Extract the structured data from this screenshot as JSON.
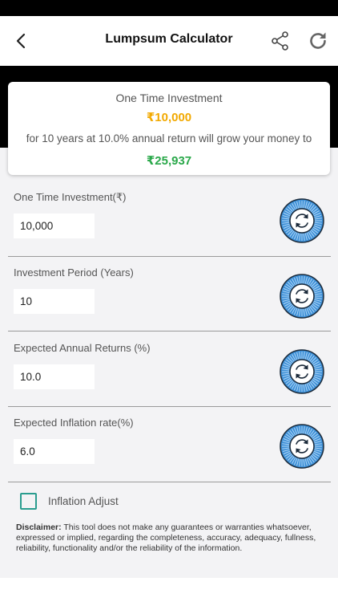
{
  "header": {
    "title": "Lumpsum Calculator",
    "back_icon": "chevron-left-icon",
    "share_icon": "share-icon",
    "refresh_icon": "refresh-icon"
  },
  "summary": {
    "title": "One Time Investment",
    "amount": "₹10,000",
    "description": "for 10 years at 10.0% annual return will grow your money to",
    "result": "₹25,937",
    "amount_color": "#f2a900",
    "result_color": "#2aa84a"
  },
  "fields": [
    {
      "label": "One Time Investment(₹)",
      "value": "10,000"
    },
    {
      "label": "Investment Period (Years)",
      "value": "10"
    },
    {
      "label": "Expected Annual Returns (%)",
      "value": "10.0"
    },
    {
      "label": "Expected Inflation rate(%)",
      "value": "6.0"
    }
  ],
  "inflation_adjust": {
    "label": "Inflation Adjust",
    "checked": false
  },
  "disclaimer": {
    "heading": "Disclaimer:",
    "text": " This tool does not make any guarantees or warranties whatsoever, expressed or implied, regarding the completeness, accuracy, adequacy, fullness, reliability, functionality and/or the reliability of the information."
  },
  "colors": {
    "accent": "#3d8fd6",
    "checkbox": "#2a9d8f"
  }
}
